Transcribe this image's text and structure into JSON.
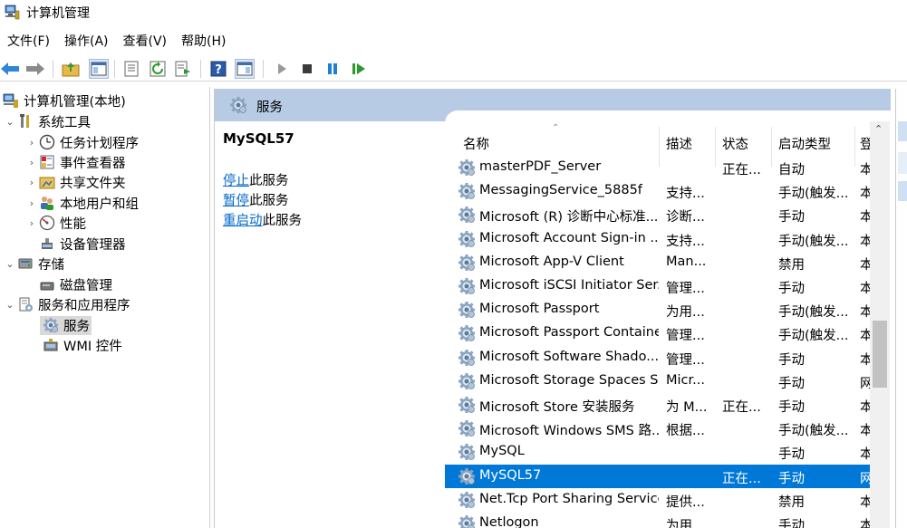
{
  "window": {
    "title": "计算机管理"
  },
  "menu": [
    "文件(F)",
    "操作(A)",
    "查看(V)",
    "帮助(H)"
  ],
  "tree": {
    "root": "计算机管理(本地)",
    "system_tools": "系统工具",
    "task_scheduler": "任务计划程序",
    "event_viewer": "事件查看器",
    "shared_folders": "共享文件夹",
    "local_users": "本地用户和组",
    "performance": "性能",
    "device_manager": "设备管理器",
    "storage": "存储",
    "disk_management": "磁盘管理",
    "services_apps": "服务和应用程序",
    "services": "服务",
    "wmi": "WMI 控件"
  },
  "middle": {
    "header": "服务",
    "selected_service": "MySQL57",
    "actions": [
      {
        "link": "停止",
        "suffix": "此服务"
      },
      {
        "link": "暂停",
        "suffix": "此服务"
      },
      {
        "link": "重启动",
        "suffix": "此服务"
      }
    ]
  },
  "list": {
    "columns": {
      "name": "名称",
      "desc": "描述",
      "status": "状态",
      "startup": "启动类型",
      "logon": "登"
    },
    "rows": [
      {
        "name": "masterPDF_Server",
        "desc": "",
        "status": "正在...",
        "startup": "自动",
        "logon": "本"
      },
      {
        "name": "MessagingService_5885f",
        "desc": "支持...",
        "status": "",
        "startup": "手动(触发...",
        "logon": "本"
      },
      {
        "name": "Microsoft (R) 诊断中心标准...",
        "desc": "诊断...",
        "status": "",
        "startup": "手动",
        "logon": "本"
      },
      {
        "name": "Microsoft Account Sign-in ...",
        "desc": "支持...",
        "status": "",
        "startup": "手动(触发...",
        "logon": "本"
      },
      {
        "name": "Microsoft App-V Client",
        "desc": "Man...",
        "status": "",
        "startup": "禁用",
        "logon": "本"
      },
      {
        "name": "Microsoft iSCSI Initiator Ser...",
        "desc": "管理...",
        "status": "",
        "startup": "手动",
        "logon": "本"
      },
      {
        "name": "Microsoft Passport",
        "desc": "为用...",
        "status": "",
        "startup": "手动(触发...",
        "logon": "本"
      },
      {
        "name": "Microsoft Passport Container",
        "desc": "管理...",
        "status": "",
        "startup": "手动(触发...",
        "logon": "本"
      },
      {
        "name": "Microsoft Software Shado...",
        "desc": "管理...",
        "status": "",
        "startup": "手动",
        "logon": "本"
      },
      {
        "name": "Microsoft Storage Spaces S...",
        "desc": "Micr...",
        "status": "",
        "startup": "手动",
        "logon": "网"
      },
      {
        "name": "Microsoft Store 安装服务",
        "desc": "为 M...",
        "status": "正在...",
        "startup": "手动",
        "logon": "本"
      },
      {
        "name": "Microsoft Windows SMS 路...",
        "desc": "根据...",
        "status": "",
        "startup": "手动(触发...",
        "logon": "本"
      },
      {
        "name": "MySQL",
        "desc": "",
        "status": "",
        "startup": "手动",
        "logon": "本"
      },
      {
        "name": "MySQL57",
        "desc": "",
        "status": "正在...",
        "startup": "手动",
        "logon": "网",
        "selected": true
      },
      {
        "name": "Net.Tcp Port Sharing Service",
        "desc": "提供...",
        "status": "",
        "startup": "禁用",
        "logon": "本"
      },
      {
        "name": "Netlogon",
        "desc": "为用...",
        "status": "",
        "startup": "手动",
        "logon": "本"
      }
    ]
  },
  "colors": {
    "selection": "#0078d7",
    "header_bar": "#b7cbe4",
    "link": "#0066cc"
  }
}
